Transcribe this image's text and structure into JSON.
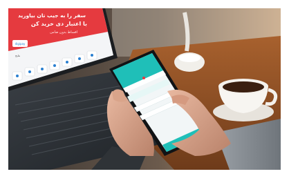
{
  "laptop_screen": {
    "headline_line1": "سفر را به جیب تان بیاورید",
    "headline_line2": "با اعتبار دی خرید کن",
    "subline": "اقساط بدون ضامن",
    "brand_logo": "digipay",
    "side_text": "نتایج",
    "icons": [
      "lightning-icon",
      "bag-icon",
      "card-icon",
      "calendar-icon",
      "gift-icon",
      "store-icon",
      "phone-icon",
      "wallet-icon"
    ]
  },
  "phone_screen": {
    "app_theme_color": "#1fbfb8",
    "accent_color": "#e8373e"
  },
  "scene": {
    "objects": [
      "laptop",
      "smartphone",
      "hands",
      "coffee-cup",
      "saucer",
      "desk-lamp",
      "wooden-table"
    ]
  }
}
